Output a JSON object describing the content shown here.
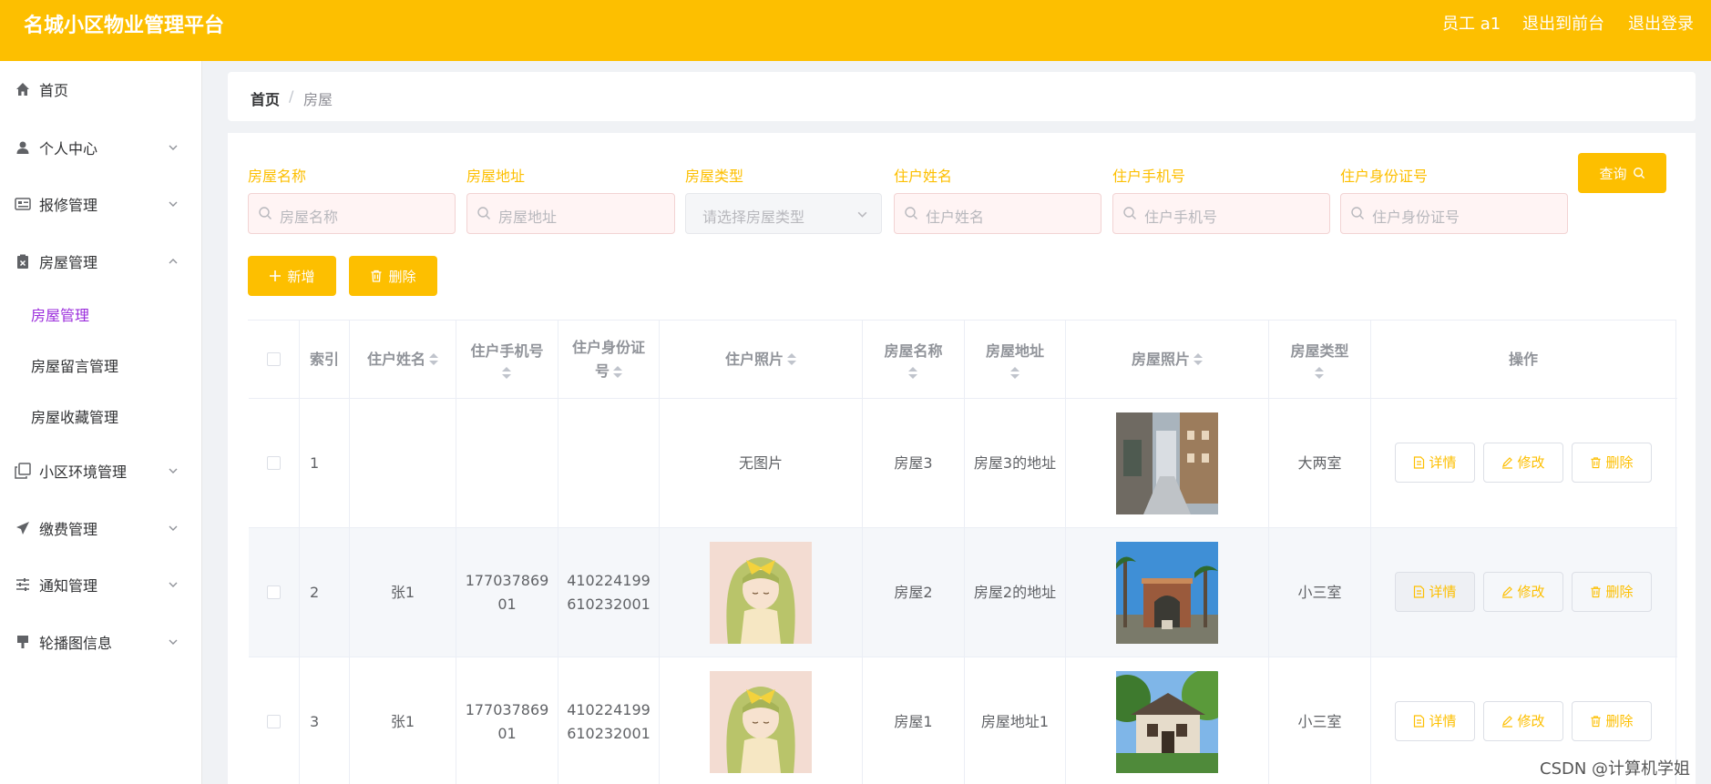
{
  "header": {
    "title": "名城小区物业管理平台",
    "user": "员工 a1",
    "front": "退出到前台",
    "logout": "退出登录"
  },
  "sidebar": {
    "items": [
      {
        "label": "首页",
        "icon": "home-icon"
      },
      {
        "label": "个人中心",
        "icon": "user-icon"
      },
      {
        "label": "报修管理",
        "icon": "repair-icon"
      },
      {
        "label": "房屋管理",
        "icon": "clipboard-icon"
      },
      {
        "label": "小区环境管理",
        "icon": "copy-icon"
      },
      {
        "label": "缴费管理",
        "icon": "send-icon"
      },
      {
        "label": "通知管理",
        "icon": "sliders-icon"
      },
      {
        "label": "轮播图信息",
        "icon": "banner-icon"
      }
    ],
    "sub_items": [
      "房屋管理",
      "房屋留言管理",
      "房屋收藏管理"
    ]
  },
  "breadcrumb": {
    "home": "首页",
    "sep": "/",
    "current": "房屋"
  },
  "filters": [
    {
      "label": "房屋名称",
      "placeholder": "房屋名称"
    },
    {
      "label": "房屋地址",
      "placeholder": "房屋地址"
    },
    {
      "label": "房屋类型",
      "placeholder": "请选择房屋类型"
    },
    {
      "label": "住户姓名",
      "placeholder": "住户姓名"
    },
    {
      "label": "住户手机号",
      "placeholder": "住户手机号"
    },
    {
      "label": "住户身份证号",
      "placeholder": "住户身份证号"
    }
  ],
  "buttons": {
    "search": "查询",
    "add": "新增",
    "delete": "删除"
  },
  "table": {
    "headers": [
      "索引",
      "住户姓名",
      "住户手机号",
      "住户身份证号",
      "住户照片",
      "房屋名称",
      "房屋地址",
      "房屋照片",
      "房屋类型",
      "操作"
    ],
    "header_lines": {
      "phone": [
        "住户手机号",
        ""
      ],
      "idcard": [
        "住户身份证",
        "号"
      ],
      "hname": [
        "房屋名称",
        ""
      ],
      "haddr": [
        "房屋地址",
        ""
      ],
      "htype": [
        "房屋类型",
        ""
      ]
    },
    "rows": [
      {
        "index": "1",
        "name": "",
        "phone1": "",
        "phone2": "",
        "id1": "",
        "id2": "",
        "photo": "无图片",
        "hname": "房屋3",
        "haddr": "房屋3的地址",
        "htype": "大两室"
      },
      {
        "index": "2",
        "name": "张1",
        "phone1": "177037869",
        "phone2": "01",
        "id1": "410224199",
        "id2": "610232001",
        "photo": "",
        "hname": "房屋2",
        "haddr": "房屋2的地址",
        "htype": "小三室"
      },
      {
        "index": "3",
        "name": "张1",
        "phone1": "177037869",
        "phone2": "01",
        "id1": "410224199",
        "id2": "610232001",
        "photo": "",
        "hname": "房屋1",
        "haddr": "房屋地址1",
        "htype": "小三室"
      }
    ],
    "actions": {
      "detail": "详情",
      "edit": "修改",
      "delete": "删除"
    }
  },
  "watermark": "CSDN @计算机学姐",
  "colors": {
    "accent": "#fdbf00",
    "active_menu": "#9b2ddc"
  }
}
